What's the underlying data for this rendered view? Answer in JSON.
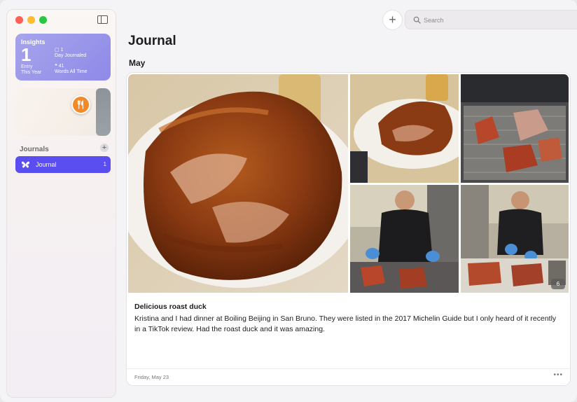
{
  "window": {
    "traffic_lights": {
      "close": "#fe5f57",
      "minimize": "#febc2e",
      "maximize": "#28c840"
    }
  },
  "sidebar": {
    "insights": {
      "title": "Insights",
      "entry_count": "1",
      "entry_label_line1": "Entry",
      "entry_label_line2": "This Year",
      "day_count": "1",
      "day_label": "Day Journaled",
      "words_count": "41",
      "words_label": "Words All Time",
      "background": "#9b97ea"
    },
    "map_card": {
      "pin_icon": "fork-knife-icon",
      "pin_color": "#f28a2a"
    },
    "journals_header": "Journals",
    "journals": [
      {
        "label": "Journal",
        "count": "1",
        "icon": "butterfly-icon",
        "color": "#5b4ef0"
      }
    ]
  },
  "toolbar": {
    "add_symbol": "+",
    "search_placeholder": "Search"
  },
  "main": {
    "title": "Journal",
    "month": "May",
    "entry": {
      "photo_count": "6",
      "title": "Delicious roast duck",
      "body": "Kristina and I had dinner at Boiling Beijing in San Bruno. They were listed in the 2017 Michelin Guide but I only heard of it recently in a TikTok review. Had the roast duck and it was amazing.",
      "date": "Friday, May 23",
      "more": "•••"
    }
  }
}
